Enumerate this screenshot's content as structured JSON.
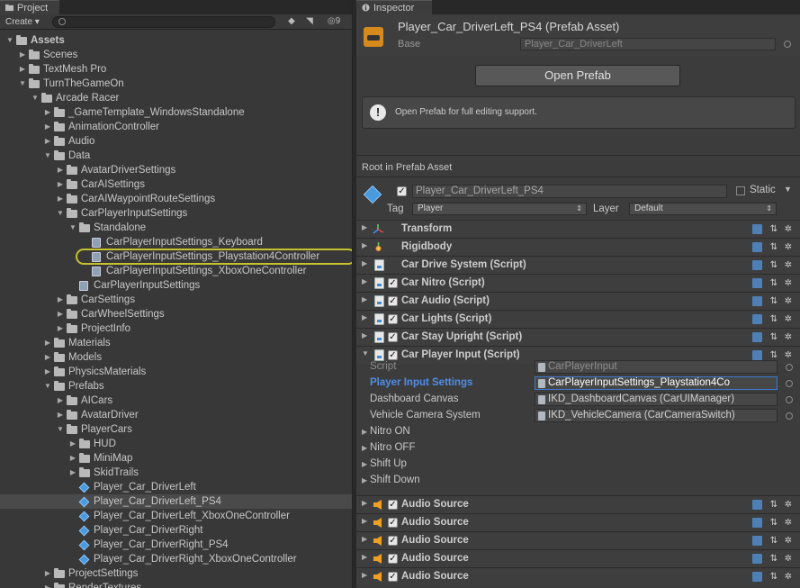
{
  "project": {
    "tab_label": "Project",
    "create_label": "Create",
    "badge": "9",
    "tree": [
      {
        "label": "Assets",
        "depth": 0,
        "open": true,
        "icon": "folder",
        "bold": true
      },
      {
        "label": "Scenes",
        "depth": 1,
        "open": false,
        "icon": "folder"
      },
      {
        "label": "TextMesh Pro",
        "depth": 1,
        "open": false,
        "icon": "folder"
      },
      {
        "label": "TurnTheGameOn",
        "depth": 1,
        "open": true,
        "icon": "folder"
      },
      {
        "label": "Arcade Racer",
        "depth": 2,
        "open": true,
        "icon": "folder"
      },
      {
        "label": "_GameTemplate_WindowsStandalone",
        "depth": 3,
        "open": false,
        "icon": "folder"
      },
      {
        "label": "AnimationController",
        "depth": 3,
        "open": false,
        "icon": "folder"
      },
      {
        "label": "Audio",
        "depth": 3,
        "open": false,
        "icon": "folder"
      },
      {
        "label": "Data",
        "depth": 3,
        "open": true,
        "icon": "folder"
      },
      {
        "label": "AvatarDriverSettings",
        "depth": 4,
        "open": false,
        "icon": "folder"
      },
      {
        "label": "CarAISettings",
        "depth": 4,
        "open": false,
        "icon": "folder"
      },
      {
        "label": "CarAIWaypointRouteSettings",
        "depth": 4,
        "open": false,
        "icon": "folder"
      },
      {
        "label": "CarPlayerInputSettings",
        "depth": 4,
        "open": true,
        "icon": "folder"
      },
      {
        "label": "Standalone",
        "depth": 5,
        "open": true,
        "icon": "folder"
      },
      {
        "label": "CarPlayerInputSettings_Keyboard",
        "depth": 6,
        "icon": "asset"
      },
      {
        "label": "CarPlayerInputSettings_Playstation4Controller",
        "depth": 6,
        "icon": "asset",
        "highlight": true
      },
      {
        "label": "CarPlayerInputSettings_XboxOneController",
        "depth": 6,
        "icon": "asset"
      },
      {
        "label": "CarPlayerInputSettings",
        "depth": 5,
        "icon": "asset"
      },
      {
        "label": "CarSettings",
        "depth": 4,
        "open": false,
        "icon": "folder"
      },
      {
        "label": "CarWheelSettings",
        "depth": 4,
        "open": false,
        "icon": "folder"
      },
      {
        "label": "ProjectInfo",
        "depth": 4,
        "open": false,
        "icon": "folder"
      },
      {
        "label": "Materials",
        "depth": 3,
        "open": false,
        "icon": "folder"
      },
      {
        "label": "Models",
        "depth": 3,
        "open": false,
        "icon": "folder"
      },
      {
        "label": "PhysicsMaterials",
        "depth": 3,
        "open": false,
        "icon": "folder"
      },
      {
        "label": "Prefabs",
        "depth": 3,
        "open": true,
        "icon": "folder"
      },
      {
        "label": "AICars",
        "depth": 4,
        "open": false,
        "icon": "folder"
      },
      {
        "label": "AvatarDriver",
        "depth": 4,
        "open": false,
        "icon": "folder"
      },
      {
        "label": "PlayerCars",
        "depth": 4,
        "open": true,
        "icon": "folder"
      },
      {
        "label": "HUD",
        "depth": 5,
        "open": false,
        "icon": "folder"
      },
      {
        "label": "MiniMap",
        "depth": 5,
        "open": false,
        "icon": "folder"
      },
      {
        "label": "SkidTrails",
        "depth": 5,
        "open": false,
        "icon": "folder"
      },
      {
        "label": "Player_Car_DriverLeft",
        "depth": 5,
        "icon": "prefab"
      },
      {
        "label": "Player_Car_DriverLeft_PS4",
        "depth": 5,
        "icon": "prefab",
        "selected": true
      },
      {
        "label": "Player_Car_DriverLeft_XboxOneController",
        "depth": 5,
        "icon": "prefab"
      },
      {
        "label": "Player_Car_DriverRight",
        "depth": 5,
        "icon": "prefab"
      },
      {
        "label": "Player_Car_DriverRight_PS4",
        "depth": 5,
        "icon": "prefab"
      },
      {
        "label": "Player_Car_DriverRight_XboxOneController",
        "depth": 5,
        "icon": "prefab"
      },
      {
        "label": "ProjectSettings",
        "depth": 3,
        "open": false,
        "icon": "folder"
      },
      {
        "label": "RenderTextures",
        "depth": 3,
        "open": false,
        "icon": "folder"
      }
    ]
  },
  "inspector": {
    "tab_label": "Inspector",
    "title": "Player_Car_DriverLeft_PS4 (Prefab Asset)",
    "base_label": "Base",
    "base_value": "Player_Car_DriverLeft",
    "open_prefab_label": "Open Prefab",
    "help_text": "Open Prefab for full editing support.",
    "root_label": "Root in Prefab Asset",
    "gameobject_name": "Player_Car_DriverLeft_PS4",
    "static_label": "Static",
    "tag_label": "Tag",
    "tag_value": "Player",
    "layer_label": "Layer",
    "layer_value": "Default",
    "components": [
      {
        "name": "Transform",
        "icon": "transform-icon",
        "checkbox": false,
        "expanded": false
      },
      {
        "name": "Rigidbody",
        "icon": "rigidbody-icon",
        "checkbox": false,
        "expanded": false
      },
      {
        "name": "Car Drive System (Script)",
        "icon": "script-icon",
        "checkbox": false,
        "expanded": false
      },
      {
        "name": "Car Nitro (Script)",
        "icon": "script-icon",
        "checkbox": true,
        "expanded": false
      },
      {
        "name": "Car Audio (Script)",
        "icon": "script-icon",
        "checkbox": true,
        "expanded": false
      },
      {
        "name": "Car Lights (Script)",
        "icon": "script-icon",
        "checkbox": true,
        "expanded": false
      },
      {
        "name": "Car Stay Upright (Script)",
        "icon": "script-icon",
        "checkbox": true,
        "expanded": false
      },
      {
        "name": "Car Player Input (Script)",
        "icon": "script-icon",
        "checkbox": true,
        "expanded": true
      }
    ],
    "player_input": {
      "script_label": "Script",
      "script_value": "CarPlayerInput",
      "settings_label": "Player Input Settings",
      "settings_value": "CarPlayerInputSettings_Playstation4Co",
      "dashboard_label": "Dashboard Canvas",
      "dashboard_value": "IKD_DashboardCanvas (CarUIManager)",
      "camera_label": "Vehicle Camera System",
      "camera_value": "IKD_VehicleCamera (CarCameraSwitch)",
      "sub_events": [
        "Nitro ON",
        "Nitro OFF",
        "Shift Up",
        "Shift Down"
      ]
    },
    "audio_sources": [
      "Audio Source",
      "Audio Source",
      "Audio Source",
      "Audio Source",
      "Audio Source"
    ]
  }
}
